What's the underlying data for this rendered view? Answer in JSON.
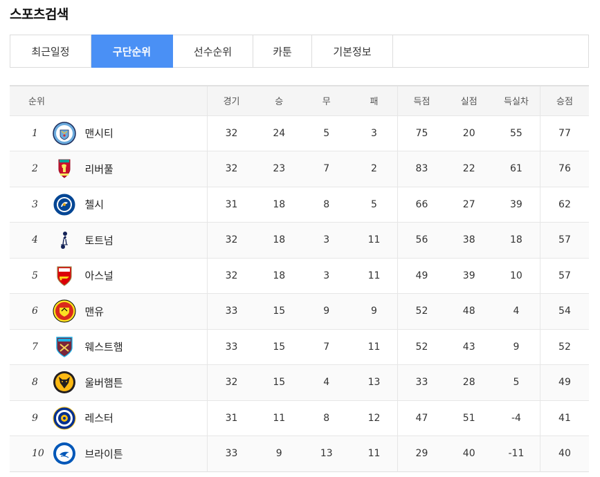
{
  "page": {
    "title": "스포츠검색"
  },
  "tabs": [
    {
      "label": "최근일정",
      "active": false
    },
    {
      "label": "구단순위",
      "active": true
    },
    {
      "label": "선수순위",
      "active": false
    },
    {
      "label": "카툰",
      "active": false
    },
    {
      "label": "기본정보",
      "active": false
    }
  ],
  "table": {
    "headers": {
      "rank": "순위",
      "played": "경기",
      "won": "승",
      "drawn": "무",
      "lost": "패",
      "goals_for": "득점",
      "goals_against": "실점",
      "goal_diff": "득실차",
      "points": "승점"
    },
    "rows": [
      {
        "rank": "1",
        "team": "맨시티",
        "crest": "man-city-crest",
        "played": "32",
        "won": "24",
        "drawn": "5",
        "lost": "3",
        "gf": "75",
        "ga": "20",
        "gd": "55",
        "pts": "77"
      },
      {
        "rank": "2",
        "team": "리버풀",
        "crest": "liverpool-crest",
        "played": "32",
        "won": "23",
        "drawn": "7",
        "lost": "2",
        "gf": "83",
        "ga": "22",
        "gd": "61",
        "pts": "76"
      },
      {
        "rank": "3",
        "team": "첼시",
        "crest": "chelsea-crest",
        "played": "31",
        "won": "18",
        "drawn": "8",
        "lost": "5",
        "gf": "66",
        "ga": "27",
        "gd": "39",
        "pts": "62"
      },
      {
        "rank": "4",
        "team": "토트넘",
        "crest": "tottenham-crest",
        "played": "32",
        "won": "18",
        "drawn": "3",
        "lost": "11",
        "gf": "56",
        "ga": "38",
        "gd": "18",
        "pts": "57"
      },
      {
        "rank": "5",
        "team": "아스널",
        "crest": "arsenal-crest",
        "played": "32",
        "won": "18",
        "drawn": "3",
        "lost": "11",
        "gf": "49",
        "ga": "39",
        "gd": "10",
        "pts": "57"
      },
      {
        "rank": "6",
        "team": "맨유",
        "crest": "man-utd-crest",
        "played": "33",
        "won": "15",
        "drawn": "9",
        "lost": "9",
        "gf": "52",
        "ga": "48",
        "gd": "4",
        "pts": "54"
      },
      {
        "rank": "7",
        "team": "웨스트햄",
        "crest": "west-ham-crest",
        "played": "33",
        "won": "15",
        "drawn": "7",
        "lost": "11",
        "gf": "52",
        "ga": "43",
        "gd": "9",
        "pts": "52"
      },
      {
        "rank": "8",
        "team": "울버햄튼",
        "crest": "wolves-crest",
        "played": "32",
        "won": "15",
        "drawn": "4",
        "lost": "13",
        "gf": "33",
        "ga": "28",
        "gd": "5",
        "pts": "49"
      },
      {
        "rank": "9",
        "team": "레스터",
        "crest": "leicester-crest",
        "played": "31",
        "won": "11",
        "drawn": "8",
        "lost": "12",
        "gf": "47",
        "ga": "51",
        "gd": "-4",
        "pts": "41"
      },
      {
        "rank": "10",
        "team": "브라이튼",
        "crest": "brighton-crest",
        "played": "33",
        "won": "9",
        "drawn": "13",
        "lost": "11",
        "gf": "29",
        "ga": "40",
        "gd": "-11",
        "pts": "40"
      }
    ]
  },
  "colors": {
    "tab_active_bg": "#4a90f5",
    "points_text": "#d0302f",
    "header_bg": "#f5f5f5"
  }
}
